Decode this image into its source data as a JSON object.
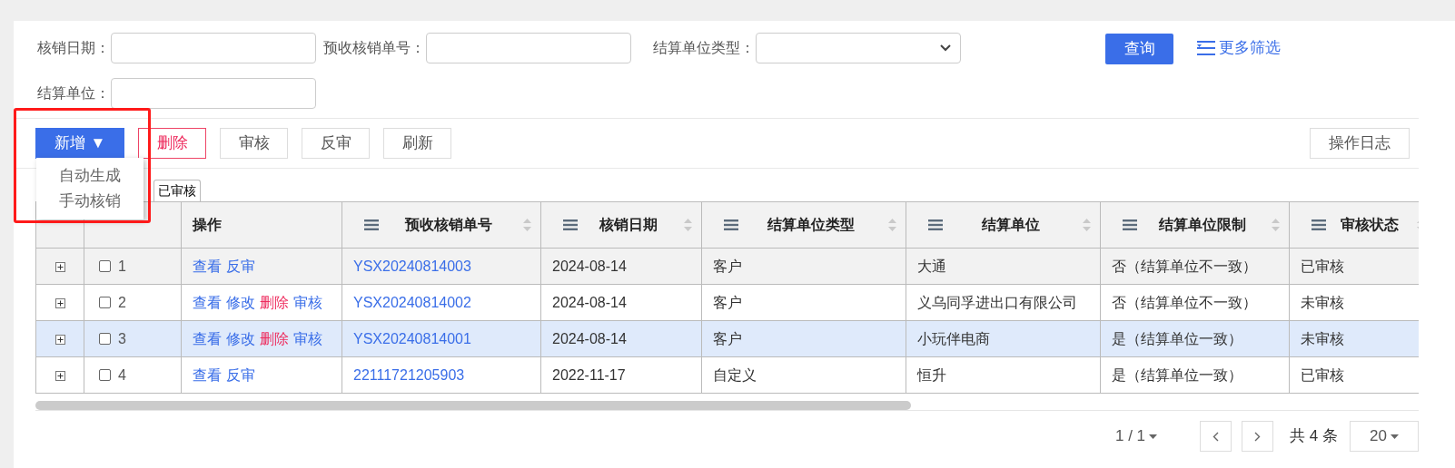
{
  "filter_rows": [
    [
      {
        "label": "核销日期：",
        "kind": "text"
      },
      {
        "label": "预收核销单号：",
        "kind": "text"
      },
      {
        "label": "结算单位类型：",
        "kind": "select"
      }
    ],
    [
      {
        "label": "结算单位：",
        "kind": "text"
      }
    ]
  ],
  "query_button": "查询",
  "more_filters": "更多筛选",
  "toolbar": [
    {
      "label": "新增",
      "kind": "primary",
      "caret": "▼"
    },
    {
      "label": "删除",
      "kind": "danger"
    },
    {
      "label": "审核",
      "kind": "plain"
    },
    {
      "label": "反审",
      "kind": "plain"
    },
    {
      "label": "刷新",
      "kind": "plain"
    }
  ],
  "log_button": "操作日志",
  "add_menu": {
    "expanded": true,
    "items": [
      "自动生成",
      "手动核销"
    ]
  },
  "tabs": [
    {
      "label": "已审核"
    }
  ],
  "table": {
    "columns": [
      {
        "kind": "expand"
      },
      {
        "kind": "index"
      },
      {
        "kind": "plain",
        "label": "操作"
      },
      {
        "kind": "sortable",
        "label": "预收核销单号"
      },
      {
        "kind": "sortable",
        "label": "核销日期"
      },
      {
        "kind": "sortable",
        "label": "结算单位类型"
      },
      {
        "kind": "sortable",
        "label": "结算单位"
      },
      {
        "kind": "sortable",
        "label": "结算单位限制"
      },
      {
        "kind": "sortable",
        "label": "审核状态"
      }
    ],
    "rows": [
      {
        "selected": false,
        "hovered": true,
        "cells": [
          {
            "kind": "expand"
          },
          {
            "kind": "index",
            "text": "1",
            "checked": false
          },
          {
            "kind": "actions",
            "actions": [
              {
                "label": "查看",
                "kind": "link"
              },
              {
                "label": "反审",
                "kind": "link"
              }
            ]
          },
          {
            "kind": "link",
            "text": "YSX20240814003"
          },
          {
            "kind": "text",
            "text": "2024-08-14"
          },
          {
            "kind": "text",
            "text": "客户"
          },
          {
            "kind": "text",
            "text": "大通"
          },
          {
            "kind": "text",
            "text": "否（结算单位不一致）"
          },
          {
            "kind": "text",
            "text": "已审核"
          }
        ]
      },
      {
        "selected": false,
        "hovered": false,
        "cells": [
          {
            "kind": "expand"
          },
          {
            "kind": "index",
            "text": "2",
            "checked": false
          },
          {
            "kind": "actions",
            "actions": [
              {
                "label": "查看",
                "kind": "link"
              },
              {
                "label": "修改",
                "kind": "link"
              },
              {
                "label": "删除",
                "kind": "danger"
              },
              {
                "label": "审核",
                "kind": "link"
              }
            ]
          },
          {
            "kind": "link",
            "text": "YSX20240814002"
          },
          {
            "kind": "text",
            "text": "2024-08-14"
          },
          {
            "kind": "text",
            "text": "客户"
          },
          {
            "kind": "text",
            "text": "义乌同孚进出口有限公司"
          },
          {
            "kind": "text",
            "text": "否（结算单位不一致）"
          },
          {
            "kind": "text",
            "text": "未审核"
          }
        ]
      },
      {
        "selected": true,
        "hovered": false,
        "cells": [
          {
            "kind": "expand"
          },
          {
            "kind": "index",
            "text": "3",
            "checked": false
          },
          {
            "kind": "actions",
            "actions": [
              {
                "label": "查看",
                "kind": "link"
              },
              {
                "label": "修改",
                "kind": "link"
              },
              {
                "label": "删除",
                "kind": "danger"
              },
              {
                "label": "审核",
                "kind": "link"
              }
            ]
          },
          {
            "kind": "link",
            "text": "YSX20240814001"
          },
          {
            "kind": "text",
            "text": "2024-08-14"
          },
          {
            "kind": "text",
            "text": "客户"
          },
          {
            "kind": "text",
            "text": "小玩伴电商"
          },
          {
            "kind": "text",
            "text": "是（结算单位一致）"
          },
          {
            "kind": "text",
            "text": "未审核"
          }
        ]
      },
      {
        "selected": false,
        "hovered": false,
        "cells": [
          {
            "kind": "expand"
          },
          {
            "kind": "index",
            "text": "4",
            "checked": false
          },
          {
            "kind": "actions",
            "actions": [
              {
                "label": "查看",
                "kind": "link"
              },
              {
                "label": "反审",
                "kind": "link"
              }
            ]
          },
          {
            "kind": "link",
            "text": "22111721205903"
          },
          {
            "kind": "text",
            "text": "2022-11-17"
          },
          {
            "kind": "text",
            "text": "自定义"
          },
          {
            "kind": "text",
            "text": "恒升"
          },
          {
            "kind": "text",
            "text": "是（结算单位一致）"
          },
          {
            "kind": "text",
            "text": "已审核"
          }
        ]
      }
    ]
  },
  "pagination": {
    "page": "1 / 1",
    "total": "共 4 条",
    "page_size": "20"
  }
}
